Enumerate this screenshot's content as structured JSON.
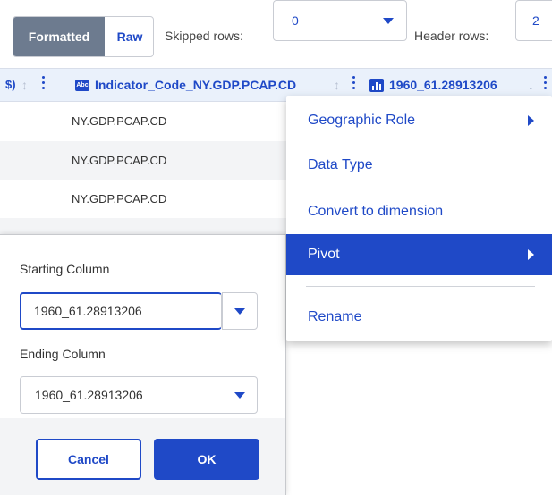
{
  "toolbar": {
    "formatted_label": "Formatted",
    "raw_label": "Raw",
    "skipped_rows_label": "Skipped rows:",
    "skipped_rows_value": "0",
    "header_rows_label": "Header rows:",
    "header_rows_value": "2"
  },
  "header": {
    "prev_column_fragment": "$)",
    "column_name": "Indicator_Code_NY.GDP.PCAP.CD",
    "column_type_icon": "abc-text-icon",
    "next_column_name": "1960_61.28913206",
    "next_column_type_icon": "measure-bars-icon"
  },
  "grid": {
    "rows": [
      "NY.GDP.PCAP.CD",
      "NY.GDP.PCAP.CD",
      "NY.GDP.PCAP.CD"
    ]
  },
  "context_menu": {
    "items": [
      {
        "label": "Geographic Role",
        "has_submenu": true
      },
      {
        "label": "Data Type",
        "has_submenu": false
      },
      {
        "label": "Convert to dimension",
        "has_submenu": false
      },
      {
        "label": "Pivot",
        "has_submenu": true,
        "active": true
      },
      {
        "label": "Rename",
        "has_submenu": false
      }
    ]
  },
  "pivot_dialog": {
    "starting_label": "Starting Column",
    "starting_value": "1960_61.28913206",
    "ending_label": "Ending Column",
    "ending_value": "1960_61.28913206",
    "cancel_label": "Cancel",
    "ok_label": "OK"
  },
  "colors": {
    "accent": "#1f49c7",
    "header_bg": "#eaf1fb",
    "segment_active": "#6d7b8f",
    "row_alt": "#f3f4f6"
  }
}
